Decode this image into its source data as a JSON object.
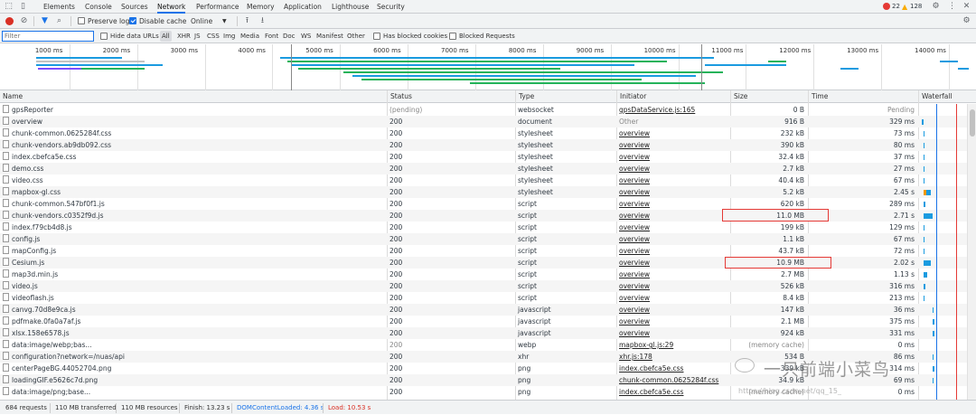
{
  "tabs": [
    "Elements",
    "Console",
    "Sources",
    "Network",
    "Performance",
    "Memory",
    "Application",
    "Lighthouse",
    "Security"
  ],
  "active_tab": "Network",
  "errors_count": "22",
  "warnings_count": "128",
  "toolbar": {
    "preserve_log": "Preserve log",
    "disable_cache": "Disable cache",
    "throttle": "Online"
  },
  "filter": {
    "placeholder": "Filter",
    "hide_data_urls": "Hide data URLs",
    "types": [
      "All",
      "XHR",
      "JS",
      "CSS",
      "Img",
      "Media",
      "Font",
      "Doc",
      "WS",
      "Manifest",
      "Other"
    ],
    "has_blocked_cookies": "Has blocked cookies",
    "blocked_requests": "Blocked Requests"
  },
  "overview_ticks": [
    "1000 ms",
    "2000 ms",
    "3000 ms",
    "4000 ms",
    "5000 ms",
    "6000 ms",
    "7000 ms",
    "8000 ms",
    "9000 ms",
    "10000 ms",
    "11000 ms",
    "12000 ms",
    "13000 ms",
    "14000 ms"
  ],
  "columns": [
    "Name",
    "Status",
    "Type",
    "Initiator",
    "Size",
    "Time",
    "Waterfall"
  ],
  "rows": [
    {
      "name": "gpsReporter",
      "status": "(pending)",
      "type": "websocket",
      "initiator": "gpsDataService.js:165",
      "size": "0 B",
      "time": "Pending",
      "link": true,
      "gray_status": true,
      "gray_time": true,
      "wf": []
    },
    {
      "name": "overview",
      "status": "200",
      "type": "document",
      "initiator": "Other",
      "size": "916 B",
      "time": "329 ms",
      "link": false,
      "gray_init": true,
      "wf": [
        [
          0,
          2,
          "#1a9be0"
        ]
      ]
    },
    {
      "name": "chunk-common.0625284f.css",
      "status": "200",
      "type": "stylesheet",
      "initiator": "overview",
      "size": "232 kB",
      "time": "73 ms",
      "link": true,
      "wf": [
        [
          2,
          1,
          "#1a9be0"
        ]
      ]
    },
    {
      "name": "chunk-vendors.ab9db092.css",
      "status": "200",
      "type": "stylesheet",
      "initiator": "overview",
      "size": "390 kB",
      "time": "80 ms",
      "link": true,
      "wf": [
        [
          2,
          1,
          "#1a9be0"
        ]
      ]
    },
    {
      "name": "index.cbefca5e.css",
      "status": "200",
      "type": "stylesheet",
      "initiator": "overview",
      "size": "32.4 kB",
      "time": "37 ms",
      "link": true,
      "wf": [
        [
          2,
          1,
          "#1a9be0"
        ]
      ]
    },
    {
      "name": "demo.css",
      "status": "200",
      "type": "stylesheet",
      "initiator": "overview",
      "size": "2.7 kB",
      "time": "27 ms",
      "link": true,
      "wf": [
        [
          2,
          1,
          "#1a9be0"
        ]
      ]
    },
    {
      "name": "video.css",
      "status": "200",
      "type": "stylesheet",
      "initiator": "overview",
      "size": "40.4 kB",
      "time": "67 ms",
      "link": true,
      "wf": [
        [
          2,
          1,
          "#1a9be0"
        ]
      ]
    },
    {
      "name": "mapbox-gl.css",
      "status": "200",
      "type": "stylesheet",
      "initiator": "overview",
      "size": "5.2 kB",
      "time": "2.45 s",
      "link": true,
      "wf": [
        [
          2,
          3,
          "#f29900"
        ],
        [
          5,
          5,
          "#1a9be0"
        ]
      ]
    },
    {
      "name": "chunk-common.547bf0f1.js",
      "status": "200",
      "type": "script",
      "initiator": "overview",
      "size": "620 kB",
      "time": "289 ms",
      "link": true,
      "wf": [
        [
          2,
          2,
          "#1a9be0"
        ]
      ]
    },
    {
      "name": "chunk-vendors.c0352f9d.js",
      "status": "200",
      "type": "script",
      "initiator": "overview",
      "size": "11.0 MB",
      "time": "2.71 s",
      "link": true,
      "wf": [
        [
          2,
          10,
          "#1a9be0"
        ]
      ]
    },
    {
      "name": "index.f79cb4d8.js",
      "status": "200",
      "type": "script",
      "initiator": "overview",
      "size": "199 kB",
      "time": "129 ms",
      "link": true,
      "wf": [
        [
          2,
          1,
          "#1a9be0"
        ]
      ]
    },
    {
      "name": "config.js",
      "status": "200",
      "type": "script",
      "initiator": "overview",
      "size": "1.1 kB",
      "time": "67 ms",
      "link": true,
      "wf": [
        [
          2,
          1,
          "#1a9be0"
        ]
      ]
    },
    {
      "name": "mapConfig.js",
      "status": "200",
      "type": "script",
      "initiator": "overview",
      "size": "43.7 kB",
      "time": "72 ms",
      "link": true,
      "wf": [
        [
          2,
          1,
          "#1a9be0"
        ]
      ]
    },
    {
      "name": "Cesium.js",
      "status": "200",
      "type": "script",
      "initiator": "overview",
      "size": "10.9 MB",
      "time": "2.02 s",
      "link": true,
      "wf": [
        [
          2,
          8,
          "#1a9be0"
        ]
      ]
    },
    {
      "name": "map3d.min.js",
      "status": "200",
      "type": "script",
      "initiator": "overview",
      "size": "2.7 MB",
      "time": "1.13 s",
      "link": true,
      "wf": [
        [
          2,
          4,
          "#1a9be0"
        ]
      ]
    },
    {
      "name": "video.js",
      "status": "200",
      "type": "script",
      "initiator": "overview",
      "size": "526 kB",
      "time": "316 ms",
      "link": true,
      "wf": [
        [
          2,
          2,
          "#1a9be0"
        ]
      ]
    },
    {
      "name": "videoflash.js",
      "status": "200",
      "type": "script",
      "initiator": "overview",
      "size": "8.4 kB",
      "time": "213 ms",
      "link": true,
      "wf": [
        [
          2,
          1,
          "#1a9be0"
        ]
      ]
    },
    {
      "name": "canvg.70d8e9ca.js",
      "status": "200",
      "type": "javascript",
      "initiator": "overview",
      "size": "147 kB",
      "time": "36 ms",
      "link": true,
      "wf": [
        [
          12,
          1,
          "#1a9be0"
        ]
      ]
    },
    {
      "name": "pdfmake.0fa0a7af.js",
      "status": "200",
      "type": "javascript",
      "initiator": "overview",
      "size": "2.1 MB",
      "time": "375 ms",
      "link": true,
      "wf": [
        [
          12,
          2,
          "#1a9be0"
        ]
      ]
    },
    {
      "name": "xlsx.158e6578.js",
      "status": "200",
      "type": "javascript",
      "initiator": "overview",
      "size": "924 kB",
      "time": "331 ms",
      "link": true,
      "wf": [
        [
          12,
          2,
          "#1a9be0"
        ]
      ]
    },
    {
      "name": "data:image/webp;bas...",
      "status": "200",
      "type": "webp",
      "initiator": "mapbox-gl.js:29",
      "size": "(memory cache)",
      "time": "0 ms",
      "link": true,
      "gray_status": true,
      "gray_size": true,
      "wf": []
    },
    {
      "name": "configuration?network=/nuas/api",
      "status": "200",
      "type": "xhr",
      "initiator": "xhr.js:178",
      "size": "534 B",
      "time": "86 ms",
      "link": true,
      "wf": [
        [
          12,
          1,
          "#1a9be0"
        ]
      ]
    },
    {
      "name": "centerPageBG.44052704.png",
      "status": "200",
      "type": "png",
      "initiator": "index.cbefca5e.css",
      "size": "339 kB",
      "time": "314 ms",
      "link": true,
      "wf": [
        [
          12,
          2,
          "#1a9be0"
        ]
      ]
    },
    {
      "name": "loadingGIF.e5626c7d.png",
      "status": "200",
      "type": "png",
      "initiator": "chunk-common.0625284f.css",
      "size": "34.9 kB",
      "time": "69 ms",
      "link": true,
      "wf": [
        [
          12,
          1,
          "#1a9be0"
        ]
      ]
    },
    {
      "name": "data:image/png;base...",
      "status": "200",
      "type": "png",
      "initiator": "index.cbefca5e.css",
      "size": "(memory cache)",
      "time": "0 ms",
      "link": true,
      "gray_size": true,
      "wf": []
    }
  ],
  "statusbar": {
    "requests": "684 requests",
    "transferred": "110 MB transferred",
    "resources": "110 MB resources",
    "finish": "Finish: 13.23 s",
    "dom_content_loaded": "DOMContentLoaded: 4.36 s",
    "load": "Load: 10.53 s"
  },
  "watermark": {
    "text": "一只前端小菜鸟",
    "url": "https://blog.csdn.net/qq_15_"
  },
  "colors": {
    "accent": "#1a73e8",
    "dcl_line": "#1a73e8",
    "load_line": "#e53935",
    "error": "#e53935",
    "warning": "#f9ab00",
    "highlight_box": "#e53935"
  }
}
